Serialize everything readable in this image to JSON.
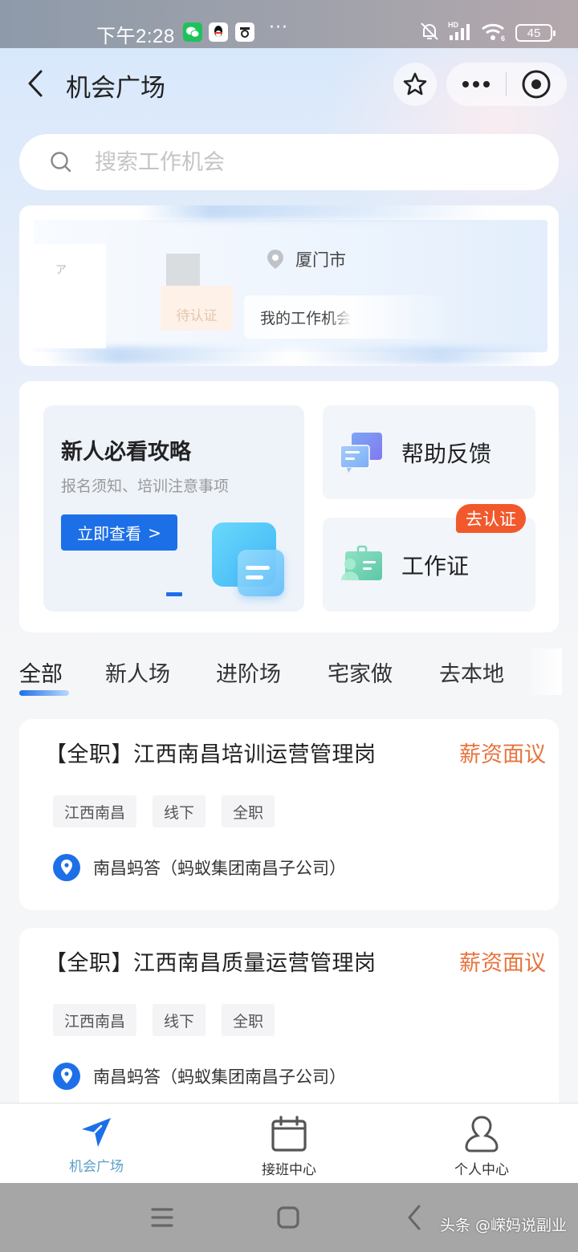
{
  "status_bar": {
    "time": "下午2:28",
    "apps": [
      "wechat-icon",
      "qq-icon",
      "camera-app-icon"
    ],
    "more": "···",
    "network_label": "HD",
    "wifi_label": "6",
    "battery": "45"
  },
  "navbar": {
    "title": "机会广场",
    "icons": {
      "back": "back-icon",
      "favorite": "star-icon",
      "more": "more-icon",
      "close": "close-miniprogram-icon"
    }
  },
  "search": {
    "placeholder": "搜索工作机会",
    "value": ""
  },
  "profile": {
    "status_badge": "待认证",
    "location": "厦门市",
    "my_work_link": "我的工作机会"
  },
  "features": {
    "guide": {
      "title": "新人必看攻略",
      "subtitle": "报名须知、培训注意事项",
      "button": "立即查看",
      "button_arrow": ">",
      "page_current": 1
    },
    "help": {
      "label": "帮助反馈"
    },
    "work_badge": {
      "label": "工作证",
      "badge": "去认证"
    }
  },
  "tabs": {
    "items": [
      "全部",
      "新人场",
      "进阶场",
      "宅家做",
      "去本地"
    ],
    "active_index": 0
  },
  "jobs": [
    {
      "title": "【全职】江西南昌培训运营管理岗",
      "salary": "薪资面议",
      "tags": [
        "江西南昌",
        "线下",
        "全职"
      ],
      "company": "南昌蚂答（蚂蚁集团南昌子公司）"
    },
    {
      "title": "【全职】江西南昌质量运营管理岗",
      "salary": "薪资面议",
      "tags": [
        "江西南昌",
        "线下",
        "全职"
      ],
      "company": "南昌蚂答（蚂蚁集团南昌子公司）"
    }
  ],
  "tabbar": {
    "items": [
      {
        "label": "机会广场",
        "icon": "send-icon",
        "active": true
      },
      {
        "label": "接班中心",
        "icon": "calendar-icon",
        "active": false
      },
      {
        "label": "个人中心",
        "icon": "user-icon",
        "active": false
      }
    ]
  },
  "system_nav": {
    "watermark": "头条 @嵘妈说副业"
  },
  "colors": {
    "primary": "#1d6fe8",
    "salary": "#e8743f",
    "badge": "#f1592c",
    "tab_active_label": "#5aa0c8"
  }
}
